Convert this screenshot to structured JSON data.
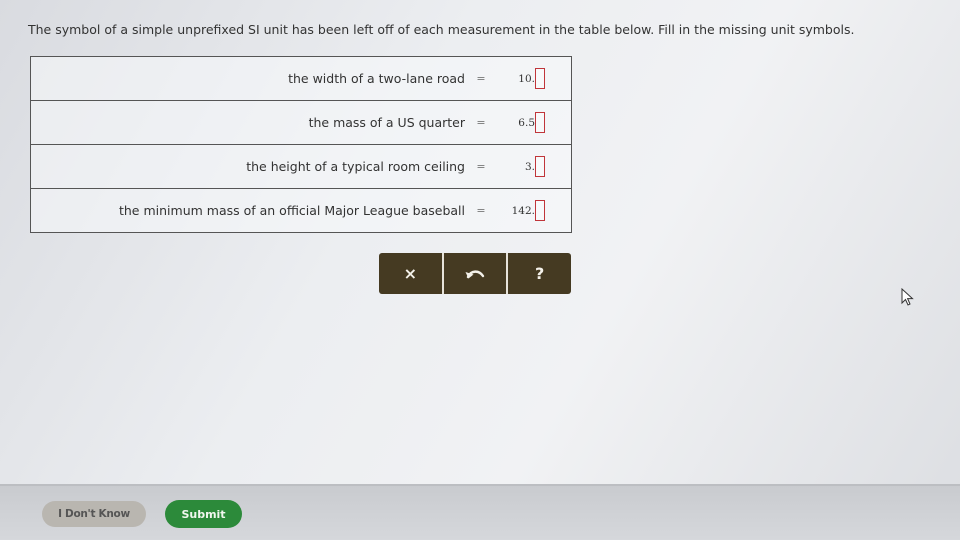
{
  "instructions": "The symbol of a simple unprefixed SI unit has been left off of each measurement in the table below. Fill in the missing unit symbols.",
  "rows": [
    {
      "label": "the width of a two-lane road",
      "equals": "=",
      "value": "10."
    },
    {
      "label": "the mass of a US quarter",
      "equals": "=",
      "value": "6.5"
    },
    {
      "label": "the height of a typical room ceiling",
      "equals": "=",
      "value": "3."
    },
    {
      "label": "the minimum mass of an official Major League baseball",
      "equals": "=",
      "value": "142."
    }
  ],
  "toolbar": {
    "clear_symbol": "×",
    "undo_icon": "undo-icon",
    "help_symbol": "?"
  },
  "footer": {
    "dont_know_label": "I Don't Know",
    "submit_label": "Submit"
  },
  "colors": {
    "toolbar_bg": "#453a22",
    "answer_box_border": "#c0353a",
    "submit_bg": "#2c8a3a",
    "dont_know_bg": "#b9b6b0"
  }
}
